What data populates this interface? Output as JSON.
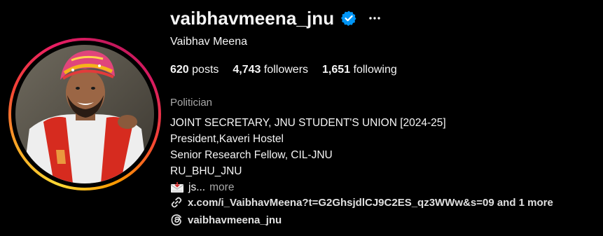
{
  "profile": {
    "username": "vaibhavmeena_jnu",
    "full_name": "Vaibhav Meena",
    "verified_icon": "verified-badge-icon",
    "more_icon": "more-options-icon",
    "stats": {
      "posts_count": "620",
      "posts_label": " posts",
      "followers_count": "4,743",
      "followers_label": " followers",
      "following_count": "1,651",
      "following_label": " following"
    },
    "category": "Politician",
    "bio": {
      "line1": "JOINT SECRETARY, JNU STUDENT'S UNION [2024-25]",
      "line2": "President,Kaveri Hostel",
      "line3": "Senior Research Fellow, CIL-JNU",
      "line4": "RU_BHU_JNU",
      "truncated": "js...",
      "more_label": "more"
    },
    "link": {
      "text": "x.com/i_VaibhavMeena?t=G2GhsjdlCJ9C2ES_qz3WWw&s=09 and 1 more"
    },
    "threads": {
      "handle": "vaibhavmeena_jnu"
    }
  },
  "colors": {
    "background": "#000000",
    "text_primary": "#f5f5f5",
    "text_secondary": "#a8a8a8",
    "verified_blue": "#0095f6"
  }
}
